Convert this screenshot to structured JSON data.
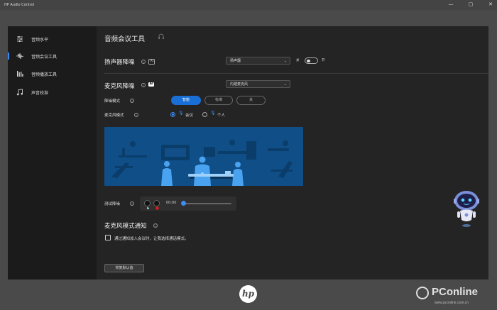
{
  "window": {
    "title": "HP Audio Control",
    "minimize": "—",
    "maximize": "▢",
    "close": "✕"
  },
  "sidebar": {
    "items": [
      {
        "label": "音频水平",
        "icon": "sliders-icon"
      },
      {
        "label": "音频会议工具",
        "icon": "waveform-icon",
        "active": true
      },
      {
        "label": "音频播放工具",
        "icon": "bars-icon"
      },
      {
        "label": "声音校准",
        "icon": "music-note-icon"
      }
    ]
  },
  "main": {
    "title": "音频会议工具",
    "speaker": {
      "title": "扬声器降噪",
      "badge": "AI",
      "dropdown": "扬声器",
      "off_label": "关",
      "on_label": "开"
    },
    "mic": {
      "title": "麦克风降噪",
      "badge": "AI",
      "dropdown": "内建麦克风",
      "mode_label": "降噪模式",
      "modes": [
        "智能",
        "标准",
        "关"
      ],
      "active_mode": 0,
      "mic_mode_label": "麦克风模式",
      "mic_modes": [
        "会议",
        "个人"
      ],
      "active_mic_mode": 0
    },
    "test": {
      "label": "测试降噪",
      "time": "00:00",
      "progress": 0
    },
    "notify": {
      "title": "麦克风模式通知",
      "checkbox_label": "通过通知加入会议时，让我选择通话模式。",
      "checked": false
    },
    "reset_label": "恢复默认值"
  },
  "branding": {
    "hp": "hp",
    "watermark": "PConline",
    "watermark_sub": "www.pconline.com.cn"
  },
  "colors": {
    "accent": "#1a6fd6",
    "illustration_bg": "#0f4e86"
  }
}
